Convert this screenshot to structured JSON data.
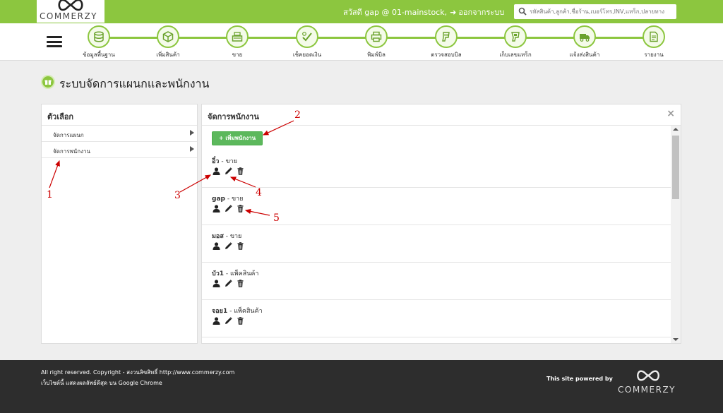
{
  "brand": {
    "logo_text": "COMMERZY",
    "accent_color": "#8cc63f"
  },
  "header": {
    "greeting": "สวัสดี gap @ 01-mainstock,",
    "logout_label": "ออกจากระบบ",
    "search_placeholder": "รหัสสินค้า,ลูกค้า,ชื่อร้าน,เบอร์โทร,INV,แทร็ก,ปลายทาง"
  },
  "nav": {
    "items": [
      {
        "label": "ข้อมูลพื้นฐาน",
        "icon": "database-icon"
      },
      {
        "label": "เพิ่มสินค้า",
        "icon": "box-icon"
      },
      {
        "label": "ขาย",
        "icon": "cash-register-icon"
      },
      {
        "label": "เช็คยอดเงิน",
        "icon": "check-money-icon"
      },
      {
        "label": "พิมพ์บิล",
        "icon": "printer-icon"
      },
      {
        "label": "ตรวจสอบบิล",
        "icon": "scanner-icon"
      },
      {
        "label": "เก็บเลขแทร็ก",
        "icon": "barcode-scanner-icon"
      },
      {
        "label": "แจ้งส่งสินค้า",
        "icon": "truck-icon"
      },
      {
        "label": "รายงาน",
        "icon": "report-icon"
      }
    ]
  },
  "page": {
    "title": "ระบบจัดการแผนกและพนักงาน"
  },
  "left_panel": {
    "heading": "ตัวเลือก",
    "items": [
      {
        "label": "จัดการแผนก"
      },
      {
        "label": "จัดการพนักงาน"
      }
    ]
  },
  "right_panel": {
    "heading": "จัดการพนักงาน",
    "close_label": "×",
    "add_button": "+ เพิ่มพนักงาน",
    "staff": [
      {
        "name": "อิ๋ว",
        "dept": " - ขาย"
      },
      {
        "name": "gap",
        "dept": " - ขาย"
      },
      {
        "name": "มอส",
        "dept": " - ขาย"
      },
      {
        "name": "บัว1",
        "dept": " - แพ็คสินค้า"
      },
      {
        "name": "จอย1",
        "dept": " - แพ็คสินค้า"
      }
    ],
    "row_actions": [
      "user-icon",
      "pencil-icon",
      "trash-icon"
    ]
  },
  "annotations": [
    "1",
    "2",
    "3",
    "4",
    "5"
  ],
  "footer": {
    "copyright": "All right reserved. Copyright - สงวนลิขสิทธิ์ http://www.commerzy.com",
    "browser_note": "เว็บไซต์นี้ แสดงผลลัพธ์ดีสุด บน Google Chrome",
    "powered_by": "This site powered by",
    "logo_text": "COMMERZY"
  }
}
